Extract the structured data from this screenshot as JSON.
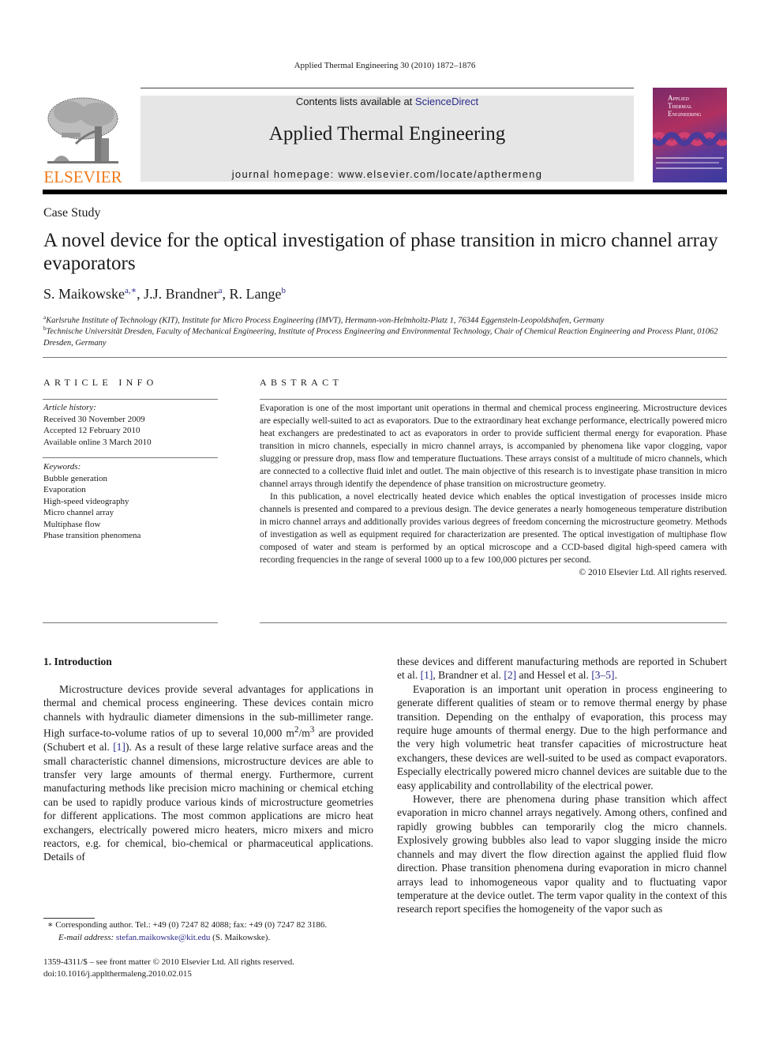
{
  "header": {
    "citation": "Applied Thermal Engineering 30 (2010) 1872–1876",
    "contents_prefix": "Contents lists available at ",
    "contents_link": "ScienceDirect",
    "journal_name": "Applied Thermal Engineering",
    "homepage_prefix": "journal homepage: ",
    "homepage_url": "www.elsevier.com/locate/apthermeng",
    "publisher_logo_text": "ELSEVIER",
    "cover_title": [
      "Applied",
      "Thermal",
      "Engineering"
    ],
    "colors": {
      "publisher_orange": "#f07a1a",
      "link_blue": "#2a2a8a",
      "band_gray": "#e6e6e6"
    }
  },
  "article": {
    "type": "Case Study",
    "title": "A novel device for the optical investigation of phase transition in micro channel array evaporators",
    "authors": [
      {
        "name": "S. Maikowske",
        "sup": "a,∗",
        "sep": ", "
      },
      {
        "name": "J.J. Brandner",
        "sup": "a",
        "sep": ", "
      },
      {
        "name": "R. Lange",
        "sup": "b",
        "sep": ""
      }
    ],
    "affiliations": [
      {
        "mark": "a",
        "text": "Karlsruhe Institute of Technology (KIT), Institute for Micro Process Engineering (IMVT), Hermann-von-Helmholtz-Platz 1, 76344 Eggenstein-Leopoldshafen, Germany"
      },
      {
        "mark": "b",
        "text": "Technische Universität Dresden, Faculty of Mechanical Engineering, Institute of Process Engineering and Environmental Technology, Chair of Chemical Reaction Engineering and Process Plant, 01062 Dresden, Germany"
      }
    ]
  },
  "article_info": {
    "heading": "ARTICLE INFO",
    "history_label": "Article history:",
    "history": [
      "Received 30 November 2009",
      "Accepted 12 February 2010",
      "Available online 3 March 2010"
    ],
    "keywords_label": "Keywords:",
    "keywords": [
      "Bubble generation",
      "Evaporation",
      "High-speed videography",
      "Micro channel array",
      "Multiphase flow",
      "Phase transition phenomena"
    ]
  },
  "abstract": {
    "heading": "ABSTRACT",
    "paragraphs": [
      "Evaporation is one of the most important unit operations in thermal and chemical process engineering. Microstructure devices are especially well-suited to act as evaporators. Due to the extraordinary heat exchange performance, electrically powered micro heat exchangers are predestinated to act as evapo­rators in order to provide sufficient thermal energy for evaporation. Phase transition in micro channels, especially in micro channel arrays, is accompanied by phenomena like vapor clogging, vapor slugging or pressure drop, mass flow and temperature fluctuations. These arrays consist of a multitude of micro channels, which are connected to a collective fluid inlet and outlet. The main objective of this research is to investigate phase transition in micro channel arrays through identify the dependence of phase transition on microstructure geometry.",
      "In this publication, a novel electrically heated device which enables the optical investigation of processes inside micro channels is presented and compared to a previous design. The device generates a nearly homogeneous temperature distribution in micro channel arrays and additionally provides various degrees of freedom concerning the microstructure geometry. Methods of investigation as well as equipment required for characterization are presented. The optical investigation of multiphase flow composed of water and steam is performed by an optical microscope and a CCD-based digital high-speed camera with recording frequencies in the range of several 1000 up to a few 100,000 pictures per second."
    ],
    "copyright": "© 2010 Elsevier Ltd. All rights reserved."
  },
  "body": {
    "section_heading": "1.  Introduction",
    "col1_p1_a": "Microstructure devices provide several advantages for applica­tions in thermal and chemical process engineering. These devices contain micro channels with hydraulic diameter dimensions in the sub-millimeter range. High surface-to-volume ratios of up to several 10,000 m",
    "col1_p1_sup1": "2",
    "col1_p1_b": "/m",
    "col1_p1_sup2": "3",
    "col1_p1_c": " are provided (Schubert et al. ",
    "ref1": "[1]",
    "col1_p1_d": "). As a result of these large relative surface areas and the small characteristic channel dimensions, microstructure devices are able to transfer very large amounts of thermal energy. Furthermore, current manufacturing methods like precision micro machining or chemical etching can be used to rapidly produce various kinds of microstructure geometries for different applications. The most common applications are micro heat exchangers, electrically powered micro heaters, micro mixers and micro reactors, e.g. for chemical, bio-chemical or pharmaceutical applications. Details of",
    "col2_p1_a": "these devices and different manufacturing methods are reported in Schubert et al. ",
    "col2_ref1": "[1]",
    "col2_p1_b": ", Brandner et al. ",
    "col2_ref2": "[2]",
    "col2_p1_c": " and Hessel et al. ",
    "col2_ref3": "[3–5]",
    "col2_p1_d": ".",
    "col2_p2": "Evaporation is an important unit operation in process engineering to generate different qualities of steam or to remove thermal energy by phase transition. Depending on the enthalpy of evaporation, this process may require huge amounts of thermal energy. Due to the high performance and the very high volumetric heat transfer capacities of microstructure heat exchangers, these devices are well-suited to be used as compact evaporators. Espe­cially electrically powered micro channel devices are suitable due to the easy applicability and controllability of the electrical power.",
    "col2_p3": "However, there are phenomena during phase transition which affect evaporation in micro channel arrays negatively. Among others, confined and rapidly growing bubbles can temporarily clog the micro channels. Explosively growing bubbles also lead to vapor slugging inside the micro channels and may divert the flow direction against the applied fluid flow direction. Phase transition phenomena during evaporation in micro channel arrays lead to inhomogeneous vapor quality and to fluctuating vapor temperature at the device outlet. The term vapor quality in the context of this research report specifies the homogeneity of the vapor such as"
  },
  "footnote": {
    "mark": "∗",
    "corresponding": " Corresponding author. Tel.: +49 (0) 7247 82 4088; fax: +49 (0) 7247 82 3186.",
    "email_label": "E-mail address:",
    "email": "stefan.maikowske@kit.edu",
    "email_suffix": " (S. Maikowske)."
  },
  "front_matter": {
    "issn": "1359-4311/$ – see front matter © 2010 Elsevier Ltd. All rights reserved.",
    "doi": "doi:10.1016/j.applthermaleng.2010.02.015"
  }
}
